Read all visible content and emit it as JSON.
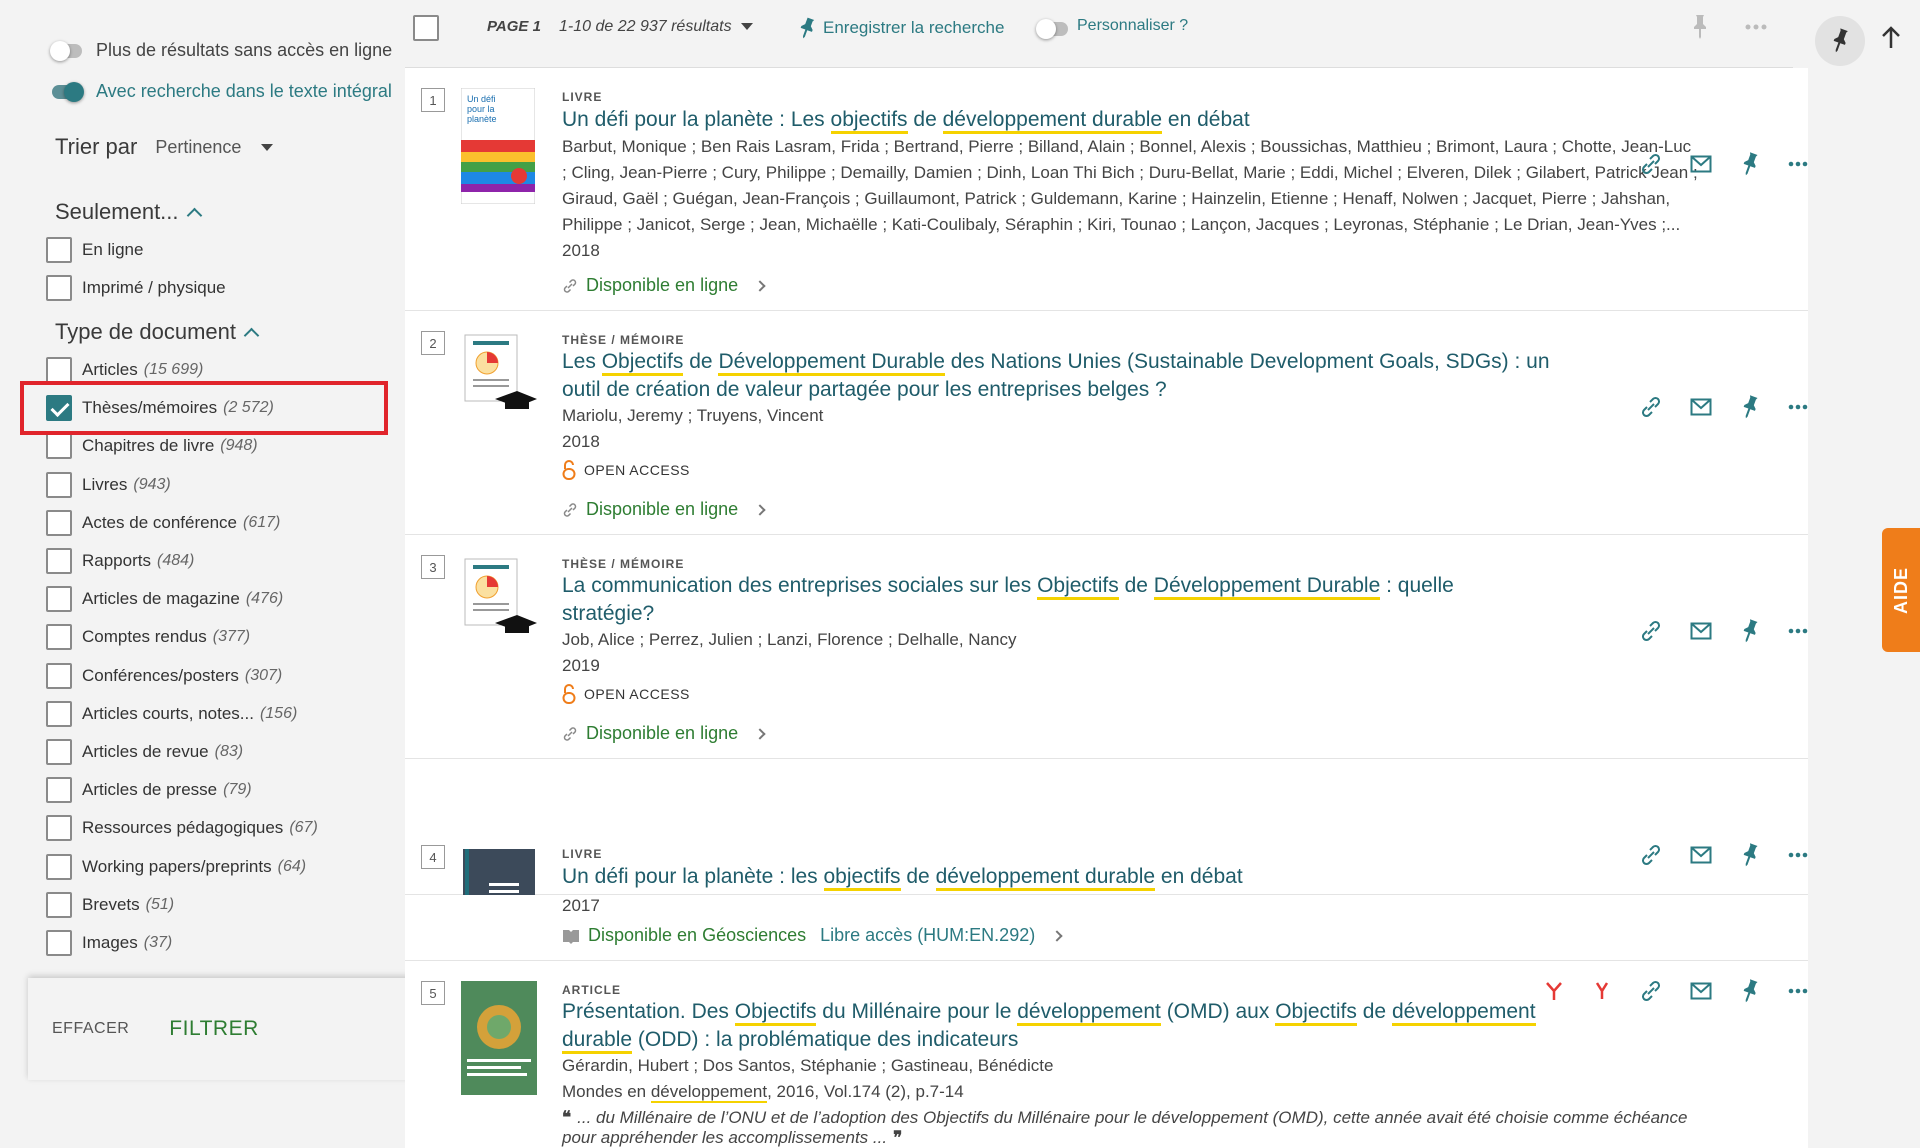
{
  "sidebar": {
    "toggle1": "Plus de résultats sans accès en ligne",
    "toggle2": "Avec recherche dans le texte intégral",
    "sort_label": "Trier par",
    "sort_value": "Pertinence",
    "only_heading": "Seulement...",
    "only_items": [
      {
        "label": "En ligne"
      },
      {
        "label": "Imprimé / physique"
      }
    ],
    "doctype_heading": "Type de document",
    "doctype_items": [
      {
        "label": "Articles",
        "count": "(15 699)",
        "checked": false
      },
      {
        "label": "Thèses/mémoires",
        "count": "(2 572)",
        "checked": true
      },
      {
        "label": "Chapitres de livre",
        "count": "(948)",
        "checked": false
      },
      {
        "label": "Livres",
        "count": "(943)",
        "checked": false
      },
      {
        "label": "Actes de conférence",
        "count": "(617)",
        "checked": false
      },
      {
        "label": "Rapports",
        "count": "(484)",
        "checked": false
      },
      {
        "label": "Articles de magazine",
        "count": "(476)",
        "checked": false
      },
      {
        "label": "Comptes rendus",
        "count": "(377)",
        "checked": false
      },
      {
        "label": "Conférences/posters",
        "count": "(307)",
        "checked": false
      },
      {
        "label": "Articles courts, notes...",
        "count": "(156)",
        "checked": false
      },
      {
        "label": "Articles de revue",
        "count": "(83)",
        "checked": false
      },
      {
        "label": "Articles de presse",
        "count": "(79)",
        "checked": false
      },
      {
        "label": "Ressources pédagogiques",
        "count": "(67)",
        "checked": false
      },
      {
        "label": "Working papers/preprints",
        "count": "(64)",
        "checked": false
      },
      {
        "label": "Brevets",
        "count": "(51)",
        "checked": false
      },
      {
        "label": "Images",
        "count": "(37)",
        "checked": false
      }
    ],
    "clear_label": "EFFACER",
    "filter_label": "FILTRER"
  },
  "topbar": {
    "page": "PAGE 1",
    "range": "1-10 de 22 937 résultats",
    "save_search": "Enregistrer la recherche",
    "personalize": "Personnaliser ?"
  },
  "aide_label": "AIDE",
  "results": [
    {
      "num": "1",
      "type": "LIVRE",
      "title_parts": [
        "Un défi pour la planète : Les ",
        "objectifs",
        " de ",
        "développement durable",
        " en débat"
      ],
      "authors": [
        "Barbut, Monique ; Ben Rais Lasram, Frida ; Bertrand, Pierre ; Billand, Alain ; Bonnel, Alexis ; Boussichas, Matthieu ; Brimont, Laura ; Chotte, Jean-Luc",
        "; Cling, Jean-Pierre ; Cury, Philippe ; Demailly, Damien ; Dinh, Loan Thi Bich ; Duru-Bellat, Marie ; Eddi, Michel ; Elveren, Dilek ; Gilabert, Patrick Jean ;",
        "Giraud, Gaël ; Guégan, Jean-François ; Guillaumont, Patrick ; Guldemann, Karine ; Hainzelin, Etienne ; Henaff, Nolwen ; Jacquet, Pierre ; Jahshan,",
        "Philippe ; Janicot, Serge ; Jean, Michaëlle ; Kati-Coulibaly, Séraphin ; Kiri, Tounao ; Lançon, Jacques ; Leyronas, Stéphanie ; Le Drian, Jean-Yves ;..."
      ],
      "year": "2018",
      "availability": "Disponible en ligne"
    },
    {
      "num": "2",
      "type": "THÈSE / MÉMOIRE",
      "title_line1": [
        "Les ",
        "Objectifs",
        " de ",
        "Développement Durable",
        " des Nations Unies (Sustainable Development Goals, SDGs) : un"
      ],
      "title_line2": "outil de création de valeur partagée pour les entreprises belges ?",
      "authors": "Mariolu, Jeremy ; Truyens, Vincent",
      "year": "2018",
      "open_access": "OPEN ACCESS",
      "availability": "Disponible en ligne"
    },
    {
      "num": "3",
      "type": "THÈSE / MÉMOIRE",
      "title_line1": [
        "La communication des entreprises sociales sur les ",
        "Objectifs",
        " de ",
        "Développement Durable",
        " : quelle"
      ],
      "title_line2": "stratégie?",
      "authors": "Job, Alice ; Perrez, Julien ; Lanzi, Florence ; Delhalle, Nancy",
      "year": "2019",
      "open_access": "OPEN ACCESS",
      "availability": "Disponible en ligne"
    },
    {
      "num": "4",
      "type": "LIVRE",
      "title_parts": [
        "Un défi pour la planète : les ",
        "objectifs",
        " de ",
        "développement durable",
        " en débat"
      ],
      "year": "2017",
      "availability": "Disponible en Géosciences",
      "location": "Libre accès (HUM:EN.292)"
    },
    {
      "num": "5",
      "type": "ARTICLE",
      "title_line1": [
        "Présentation. Des ",
        "Objectifs",
        " du Millénaire pour le ",
        "développement",
        " (OMD) aux ",
        "Objectifs",
        " de ",
        "développement"
      ],
      "title_line2": [
        "durable",
        " (ODD) : la problématique des indicateurs"
      ],
      "authors": "Gérardin, Hubert ; Dos Santos, Stéphanie ; Gastineau, Bénédicte",
      "source_parts": [
        "Mondes en ",
        "développement",
        ", 2016, Vol.174 (2), p.7-14"
      ],
      "snippet_line1": "... du Millénaire de l’ONU et de l’adoption des Objectifs du Millénaire pour le développement (OMD), cette année avait été choisie comme échéance",
      "snippet_line2": "pour appréhender les accomplissements ..."
    }
  ]
}
